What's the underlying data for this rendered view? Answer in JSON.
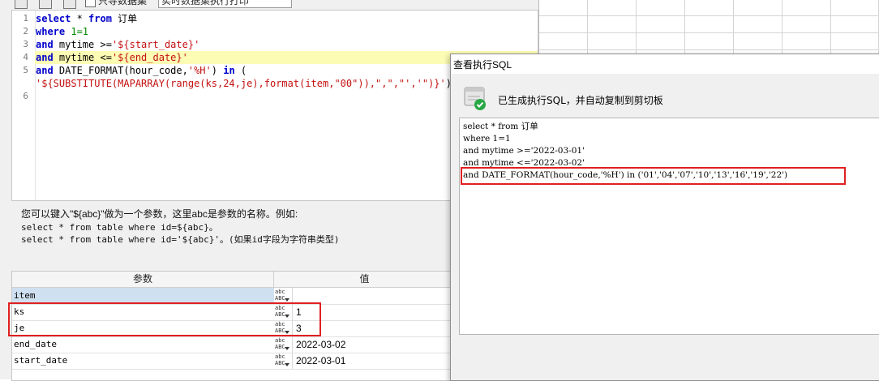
{
  "toolbar": {
    "checkbox_label": "只导数据集",
    "combo_value": "实时数据集执行打印"
  },
  "editor": {
    "lines": [
      {
        "n": "1",
        "tokens": [
          {
            "t": "select",
            "c": "kw"
          },
          {
            "t": " * ",
            "c": ""
          },
          {
            "t": "from",
            "c": "kw"
          },
          {
            "t": " 订单",
            "c": ""
          }
        ]
      },
      {
        "n": "2",
        "tokens": [
          {
            "t": "where",
            "c": "kw"
          },
          {
            "t": " ",
            "c": ""
          },
          {
            "t": "1=1",
            "c": "num"
          }
        ]
      },
      {
        "n": "3",
        "tokens": [
          {
            "t": "and",
            "c": "kw"
          },
          {
            "t": " mytime >=",
            "c": ""
          },
          {
            "t": "'${start_date}'",
            "c": "str"
          }
        ]
      },
      {
        "n": "4",
        "tokens": [
          {
            "t": "and",
            "c": "kw"
          },
          {
            "t": " mytime <=",
            "c": ""
          },
          {
            "t": "'${end_date}'",
            "c": "str"
          }
        ],
        "highlight": true
      },
      {
        "n": "5",
        "tokens": [
          {
            "t": "and",
            "c": "kw"
          },
          {
            "t": " DATE_FORMAT(hour_code,",
            "c": ""
          },
          {
            "t": "'%H'",
            "c": "str"
          },
          {
            "t": ") ",
            "c": ""
          },
          {
            "t": "in",
            "c": "kw"
          },
          {
            "t": " (",
            "c": ""
          }
        ]
      },
      {
        "n": "",
        "tokens": [
          {
            "t": "'${SUBSTITUTE(MAPARRAY(range(ks,24,je),format(item,\"00\")),\",\",\"','\")}'",
            "c": "str"
          },
          {
            "t": ")",
            "c": ""
          }
        ]
      },
      {
        "n": "6",
        "tokens": []
      }
    ]
  },
  "help": {
    "line1": "您可以键入\"${abc}\"做为一个参数，这里abc是参数的名称。例如:",
    "line2": "select * from table where id=${abc}。",
    "line3": "select * from table where id='${abc}'。(如果id字段为字符串类型)"
  },
  "params": {
    "col_param": "参数",
    "col_value": "值",
    "rows": [
      {
        "name": "item",
        "value": "",
        "selected": true
      },
      {
        "name": "ks",
        "value": "1"
      },
      {
        "name": "je",
        "value": "3"
      },
      {
        "name": "end_date",
        "value": "2022-03-02"
      },
      {
        "name": "start_date",
        "value": "2022-03-01"
      }
    ],
    "type_icon_top": "abc",
    "type_icon_bottom": "ABC"
  },
  "dialog": {
    "title": "查看执行SQL",
    "message": "已生成执行SQL，并自动复制到剪切板",
    "lines": [
      "select * from 订单",
      "where 1=1",
      "and mytime >='2022-03-01'",
      "and mytime <='2022-03-02'",
      "and DATE_FORMAT(hour_code,'%H') in ('01','04','07','10','13','16','19','22')"
    ]
  },
  "colors": {
    "highlight": "#e02020",
    "keyword": "#0000cc",
    "string": "#c41010",
    "current_line": "#fdfcb4"
  }
}
